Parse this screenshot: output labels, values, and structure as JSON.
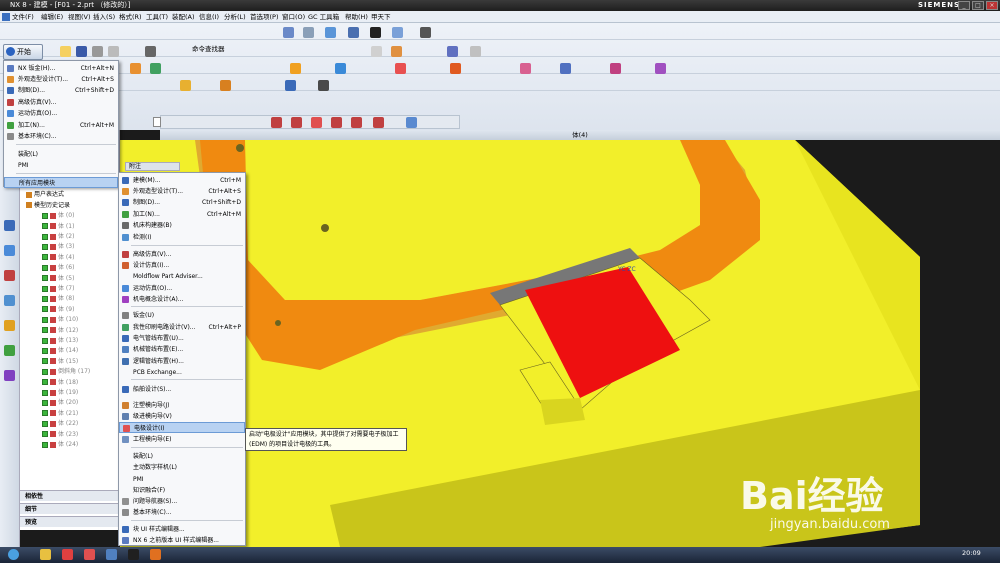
{
  "titlebar": {
    "title": "NX 8 - 建模 - [F01 - 2.prt （修改的）]",
    "brand": "SIEMENS"
  },
  "menubar": {
    "items": [
      "文件(F)",
      "编辑(E)",
      "视图(V)",
      "插入(S)",
      "格式(R)",
      "工具(T)",
      "装配(A)",
      "信息(I)",
      "分析(L)",
      "首选项(P)",
      "窗口(O)",
      "GC 工具箱",
      "帮助(H)",
      "甲天下"
    ]
  },
  "start_button": {
    "label": "开始"
  },
  "toolbar": {
    "command_finder": "命令查找器"
  },
  "viewport": {
    "title": "体(4)"
  },
  "start_menu": {
    "items": [
      {
        "label": "NX 钣金(H)...",
        "shortcut": "Ctrl+Alt+N"
      },
      {
        "label": "外观造型设计(T)...",
        "shortcut": "Ctrl+Alt+S"
      },
      {
        "label": "制图(D)...",
        "shortcut": "Ctrl+Shift+D"
      },
      {
        "label": "高级仿真(V)...",
        "shortcut": ""
      },
      {
        "label": "运动仿真(O)...",
        "shortcut": ""
      },
      {
        "label": "加工(N)...",
        "shortcut": "Ctrl+Alt+M"
      },
      {
        "label": "基本环境(C)...",
        "shortcut": ""
      },
      {
        "label": "装配(L)",
        "shortcut": ""
      },
      {
        "label": "PMI",
        "shortcut": ""
      },
      {
        "label": "所有应用模块",
        "shortcut": ""
      }
    ]
  },
  "submenu": {
    "items": [
      {
        "label": "建模(M)...",
        "shortcut": "Ctrl+M"
      },
      {
        "label": "外观造型设计(T)...",
        "shortcut": "Ctrl+Alt+S"
      },
      {
        "label": "制图(D)...",
        "shortcut": "Ctrl+Shift+D"
      },
      {
        "label": "加工(N)...",
        "shortcut": "Ctrl+Alt+M"
      },
      {
        "label": "机床构建器(B)",
        "shortcut": ""
      },
      {
        "label": "检测(I)",
        "shortcut": ""
      },
      {
        "label": "高级仿真(V)...",
        "shortcut": ""
      },
      {
        "label": "设计仿真(I)...",
        "shortcut": ""
      },
      {
        "label": "Moldflow Part Adviser...",
        "shortcut": ""
      },
      {
        "label": "运动仿真(O)...",
        "shortcut": ""
      },
      {
        "label": "机电概念设计(A)...",
        "shortcut": ""
      },
      {
        "label": "钣金(U)",
        "shortcut": ""
      },
      {
        "label": "我性印刷电路设计(V)...",
        "shortcut": "Ctrl+Alt+P"
      },
      {
        "label": "电气管线布置(U)...",
        "shortcut": ""
      },
      {
        "label": "机械管线布置(E)...",
        "shortcut": ""
      },
      {
        "label": "逻辑管线布置(H)...",
        "shortcut": ""
      },
      {
        "label": "PCB Exchange...",
        "shortcut": ""
      },
      {
        "label": "船舶设计(S)...",
        "shortcut": ""
      },
      {
        "label": "注塑模向导(J)",
        "shortcut": ""
      },
      {
        "label": "级进模向导(V)",
        "shortcut": ""
      },
      {
        "label": "电极设计(I)",
        "shortcut": ""
      },
      {
        "label": "工程模向导(E)",
        "shortcut": ""
      },
      {
        "label": "装配(L)",
        "shortcut": ""
      },
      {
        "label": "主动数字样机(L)",
        "shortcut": ""
      },
      {
        "label": "PMI",
        "shortcut": ""
      },
      {
        "label": "知识融合(F)",
        "shortcut": ""
      },
      {
        "label": "问题导航器(S)...",
        "shortcut": ""
      },
      {
        "label": "基本环境(C)...",
        "shortcut": ""
      },
      {
        "label": "块 UI 样式编辑器...",
        "shortcut": ""
      },
      {
        "label": "NX 6 之前版本 UI 样式编辑器...",
        "shortcut": ""
      }
    ]
  },
  "tooltip": {
    "text": "启动\"电极设计\"应用模块，其中提供了对需要电子极加工 (EDM) 的项目设计电极的工具。"
  },
  "navigator": {
    "column_header": "附注",
    "items": [
      "摄像机",
      "用户表达式",
      "模型历史记录",
      "体 (0)",
      "体 (1)",
      "体 (2)",
      "体 (3)",
      "体 (4)",
      "体 (6)",
      "体 (5)",
      "体 (7)",
      "体 (8)",
      "体 (9)",
      "体 (10)",
      "体 (12)",
      "体 (13)",
      "体 (14)",
      "体 (15)",
      "倒斜角 (17)",
      "体 (18)",
      "体 (19)",
      "体 (20)",
      "体 (21)",
      "体 (22)",
      "体 (23)",
      "体 (24)"
    ],
    "panels": [
      "相依性",
      "细节",
      "预览"
    ]
  },
  "watermark": {
    "brand": "Bai经验",
    "url": "jingyan.baidu.com"
  },
  "taskbar": {
    "clock": "20:09"
  },
  "colors": {
    "yellow_part": "#f2ef2a",
    "orange_part": "#f08a10",
    "red_electrode": "#ee1010",
    "highlight": "#b8d2f2"
  }
}
